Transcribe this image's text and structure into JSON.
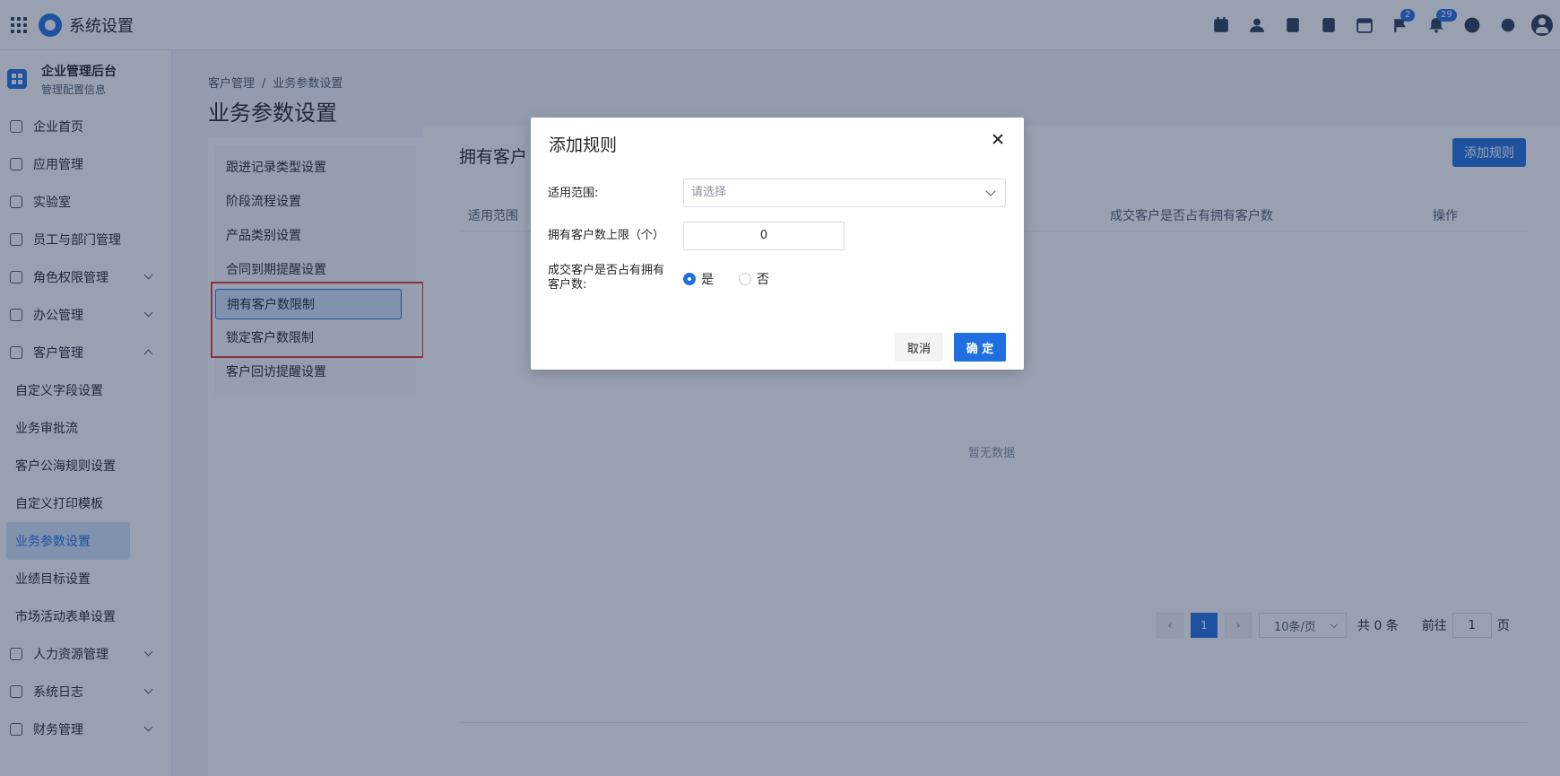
{
  "app": {
    "title": "系统设置"
  },
  "topbar": {
    "icons": [
      "calendar-check-icon",
      "contacts-icon",
      "document-icon",
      "phone-icon",
      "calendar-icon",
      "flag-icon",
      "bell-icon",
      "help-icon",
      "gear-icon",
      "user-avatar-icon"
    ],
    "flag_badge": "2",
    "bell_badge": "29"
  },
  "sidebar": {
    "org_name": "企业管理后台",
    "org_sub": "管理配置信息",
    "items": [
      {
        "label": "企业首页",
        "icon": "home-icon"
      },
      {
        "label": "应用管理",
        "icon": "apps-icon"
      },
      {
        "label": "实验室",
        "icon": "lab-icon"
      },
      {
        "label": "员工与部门管理",
        "icon": "people-icon"
      },
      {
        "label": "角色权限管理",
        "icon": "role-icon"
      },
      {
        "label": "办公管理",
        "icon": "briefcase-icon"
      },
      {
        "label": "客户管理",
        "icon": "customer-icon"
      }
    ],
    "sub_items": [
      "自定义字段设置",
      "业务审批流",
      "客户公海规则设置",
      "自定义打印模板",
      "业务参数设置",
      "业绩目标设置",
      "市场活动表单设置"
    ],
    "bottom_items": [
      {
        "label": "人力资源管理",
        "icon": "hr-icon"
      },
      {
        "label": "系统日志",
        "icon": "log-icon"
      },
      {
        "label": "财务管理",
        "icon": "finance-icon"
      }
    ]
  },
  "breadcrumb": {
    "root": "客户管理",
    "sep": "/",
    "current": "业务参数设置"
  },
  "page": {
    "title": "业务参数设置"
  },
  "settings_menu": [
    "跟进记录类型设置",
    "阶段流程设置",
    "产品类别设置",
    "合同到期提醒设置",
    "拥有客户数限制",
    "锁定客户数限制",
    "客户回访提醒设置"
  ],
  "content": {
    "title": "拥有客户",
    "add_button": "添加规则",
    "columns": [
      "适用范围",
      "成交客户是否占有拥有客户数",
      "操作"
    ],
    "empty_text": "暂无数据"
  },
  "pagination": {
    "current_page": "1",
    "page_size": "10条/页",
    "total": "共 0 条",
    "goto_label": "前往",
    "goto_value": "1",
    "page_unit": "页"
  },
  "dialog": {
    "title": "添加规则",
    "scope_label": "适用范围:",
    "scope_placeholder": "请选择",
    "limit_label": "拥有客户数上限（个）",
    "limit_value": "0",
    "occupy_label_line1": "成交客户是否占有拥有",
    "occupy_label_line2": "客户数:",
    "option_yes": "是",
    "option_no": "否",
    "cancel": "取消",
    "confirm": "确 定"
  },
  "colors": {
    "accent": "#1f6fe0",
    "highlight_border": "#e03a2f"
  }
}
